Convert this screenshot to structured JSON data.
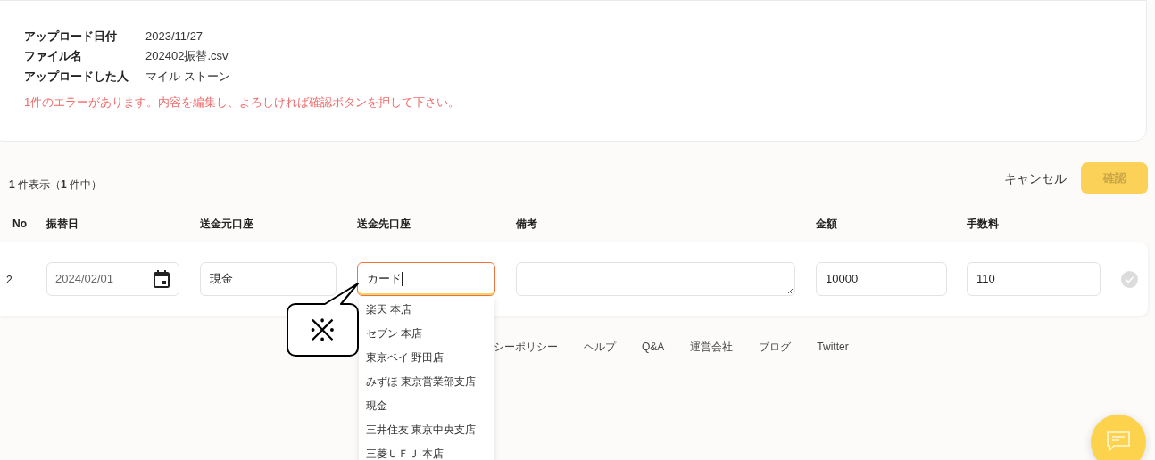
{
  "upload_info": [
    {
      "label": "アップロード日付",
      "value": "2023/11/27"
    },
    {
      "label": "ファイル名",
      "value": "202402振替.csv"
    },
    {
      "label": "アップロードした人",
      "value": "マイル ストーン"
    }
  ],
  "error_message": "1件のエラーがあります。内容を編集し、よろしければ確認ボタンを押して下さい。",
  "count_text": "**1** 件表示（**1** 件中）",
  "cancel_button": "キャンセル",
  "confirm_button": {
    "label": "確認",
    "disabled": true
  },
  "table": {
    "columns": [
      "No",
      "振替日",
      "送金元口座",
      "送金先口座",
      "備考",
      "金額",
      "手数料"
    ],
    "rows": [
      {
        "no": "2",
        "date": "2024/02/01",
        "from_account": "現金",
        "to_account": "カード",
        "note": "",
        "amount": "10000",
        "fee": "110",
        "to_account_error": true,
        "checked": false
      }
    ]
  },
  "dropdown": {
    "items": [
      "楽天 本店",
      "セブン 本店",
      "東京ベイ 野田店",
      "みずほ 東京営業部支店",
      "現金",
      "三井住友 東京中央支店",
      "三菱ＵＦＪ 本店"
    ]
  },
  "callout": "※",
  "footer_links": [
    "シーポリシー",
    "ヘルプ",
    "Q&A",
    "運営会社",
    "ブログ",
    "Twitter"
  ]
}
